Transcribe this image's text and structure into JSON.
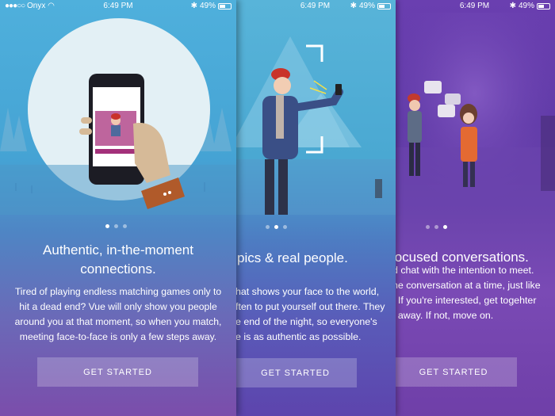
{
  "status_bar": {
    "carrier": "Onyx",
    "time": "6:49 PM",
    "battery": "49%"
  },
  "screens": [
    {
      "heading_line1": "Authentic, in-the-moment",
      "heading_line2": "connections.",
      "body_lines": [
        "Tired of playing endless matching games only to",
        "hit a dead end? Vue will only show you people",
        "around you at that moment, so when you match,",
        "meeting face-to-face is only a few steps away."
      ],
      "cta": "GET STARTED",
      "active_page": 1
    },
    {
      "heading_line1": "pics & real people.",
      "body_lines": [
        "hat shows your face to the world,",
        "ften to put yourself out there. They",
        "e end of the night, so everyone's",
        "e is as authentic as possible."
      ],
      "cta": "GET STARTED",
      "active_page": 2
    },
    {
      "heading_line1": "focused conversations.",
      "body_lines": [
        "d chat with the intention to meet.",
        "he conversation at a time, just like",
        ". If you're interested, get togehter",
        "t away. If not, move on."
      ],
      "cta": "GET STARTED",
      "active_page": 3
    }
  ],
  "colors": {
    "screen1_bg": "#4fb0dc",
    "screen2_bg": "#58b4d9",
    "screen3_bg": "#6a3fb0",
    "cta_bg": "rgba(255,255,255,0.22)"
  },
  "icons": [
    "signal-dots-icon",
    "wifi-icon",
    "bluetooth-icon",
    "battery-icon",
    "chat-bubble-icon"
  ]
}
